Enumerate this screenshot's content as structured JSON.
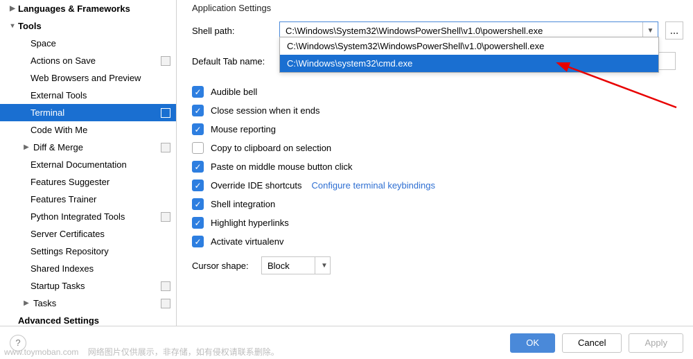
{
  "sidebar": {
    "languages": {
      "label": "Languages & Frameworks",
      "expanded": false
    },
    "tools": {
      "label": "Tools",
      "items": [
        {
          "label": "Space",
          "badge": false
        },
        {
          "label": "Actions on Save",
          "badge": true
        },
        {
          "label": "Web Browsers and Preview",
          "badge": false
        },
        {
          "label": "External Tools",
          "badge": false
        },
        {
          "label": "Terminal",
          "badge": true,
          "selected": true
        },
        {
          "label": "Code With Me",
          "badge": false
        },
        {
          "label": "Diff & Merge",
          "badge": true,
          "expandable": true
        },
        {
          "label": "External Documentation",
          "badge": false
        },
        {
          "label": "Features Suggester",
          "badge": false
        },
        {
          "label": "Features Trainer",
          "badge": false
        },
        {
          "label": "Python Integrated Tools",
          "badge": true
        },
        {
          "label": "Server Certificates",
          "badge": false
        },
        {
          "label": "Settings Repository",
          "badge": false
        },
        {
          "label": "Shared Indexes",
          "badge": false
        },
        {
          "label": "Startup Tasks",
          "badge": true
        },
        {
          "label": "Tasks",
          "badge": true,
          "expandable": true
        }
      ]
    },
    "advanced": {
      "label": "Advanced Settings"
    }
  },
  "section": {
    "title": "Application Settings"
  },
  "shell": {
    "label": "Shell path:",
    "value": "C:\\Windows\\System32\\WindowsPowerShell\\v1.0\\powershell.exe",
    "options": [
      "C:\\Windows\\System32\\WindowsPowerShell\\v1.0\\powershell.exe",
      "C:\\Windows\\system32\\cmd.exe"
    ]
  },
  "tabname": {
    "label": "Default Tab name:",
    "value": ""
  },
  "checkboxes": [
    {
      "label": "Audible bell",
      "checked": true
    },
    {
      "label": "Close session when it ends",
      "checked": true
    },
    {
      "label": "Mouse reporting",
      "checked": true
    },
    {
      "label": "Copy to clipboard on selection",
      "checked": false
    },
    {
      "label": "Paste on middle mouse button click",
      "checked": true
    },
    {
      "label": "Override IDE shortcuts",
      "checked": true,
      "link": "Configure terminal keybindings"
    },
    {
      "label": "Shell integration",
      "checked": true
    },
    {
      "label": "Highlight hyperlinks",
      "checked": true
    },
    {
      "label": "Activate virtualenv",
      "checked": true
    }
  ],
  "cursor": {
    "label": "Cursor shape:",
    "value": "Block"
  },
  "footer": {
    "ok": "OK",
    "cancel": "Cancel",
    "apply": "Apply"
  },
  "more_glyph": "…",
  "watermark": {
    "host": "www.toymoban.com",
    "note": "网络图片仅供展示，非存储，如有侵权请联系删除。"
  }
}
